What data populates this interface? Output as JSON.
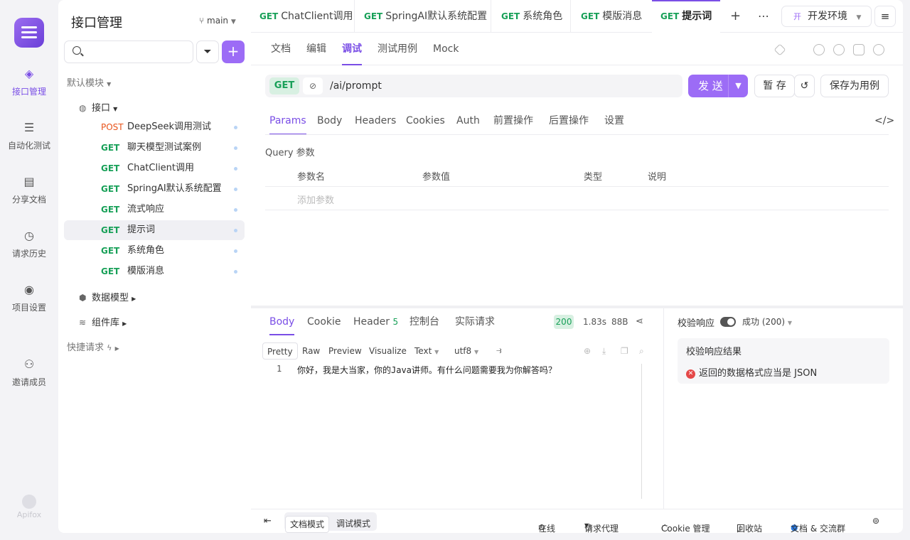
{
  "rail": {
    "items": [
      {
        "label": "接口管理",
        "icon": "api-icon"
      },
      {
        "label": "自动化测试",
        "icon": "automation-icon"
      },
      {
        "label": "分享文档",
        "icon": "book-icon"
      },
      {
        "label": "请求历史",
        "icon": "clock-icon"
      },
      {
        "label": "项目设置",
        "icon": "settings-icon"
      },
      {
        "label": "邀请成员",
        "icon": "add-user-icon"
      }
    ],
    "brand": "Apifox"
  },
  "sidebar": {
    "title": "接口管理",
    "branch": "main",
    "default_module": "默认模块",
    "api_folder": "接口",
    "items": [
      {
        "method": "POST",
        "name": "DeepSeek调用测试"
      },
      {
        "method": "GET",
        "name": "聊天模型测试案例"
      },
      {
        "method": "GET",
        "name": "ChatClient调用"
      },
      {
        "method": "GET",
        "name": "SpringAI默认系统配置"
      },
      {
        "method": "GET",
        "name": "流式响应"
      },
      {
        "method": "GET",
        "name": "提示词"
      },
      {
        "method": "GET",
        "name": "系统角色"
      },
      {
        "method": "GET",
        "name": "模版消息"
      }
    ],
    "data_models": "数据模型",
    "components": "组件库",
    "quick_requests": "快捷请求"
  },
  "tabs": [
    {
      "method": "GET",
      "label": "ChatClient调用"
    },
    {
      "method": "GET",
      "label": "SpringAI默认系统配置"
    },
    {
      "method": "GET",
      "label": "系统角色"
    },
    {
      "method": "GET",
      "label": "模版消息"
    },
    {
      "method": "GET",
      "label": "提示词"
    }
  ],
  "env": {
    "badge": "开",
    "label": "开发环境"
  },
  "subtabs": [
    "文档",
    "编辑",
    "调试",
    "测试用例",
    "Mock"
  ],
  "request": {
    "method": "GET",
    "path": "/ai/prompt",
    "send": "发 送",
    "save_temp": "暂 存",
    "save_case": "保存为用例"
  },
  "param_tabs": [
    "Params",
    "Body",
    "Headers",
    "Cookies",
    "Auth",
    "前置操作",
    "后置操作",
    "设置"
  ],
  "query": {
    "label": "Query 参数",
    "columns": [
      "参数名",
      "参数值",
      "类型",
      "说明"
    ],
    "add_placeholder": "添加参数"
  },
  "response": {
    "tabs": [
      "Body",
      "Cookie",
      "Header",
      "控制台",
      "实际请求"
    ],
    "header_count": "5",
    "status": "200",
    "time": "1.83s",
    "size": "88B",
    "formats": [
      "Pretty",
      "Raw",
      "Preview",
      "Visualize"
    ],
    "type": "Text",
    "encoding": "utf8",
    "line_no": "1",
    "body": "你好，我是大当家，你的Java讲师。有什么问题需要我为你解答吗？"
  },
  "validation": {
    "label": "校验响应",
    "state": "成功 (200)",
    "result_title": "校验响应结果",
    "error": "返回的数据格式应当是 JSON"
  },
  "footer": {
    "doc_mode": "文档模式",
    "debug_mode": "调试模式",
    "online": "在线",
    "proxy": "请求代理",
    "cookie": "Cookie 管理",
    "trash": "回收站",
    "community": "文档 & 交流群"
  }
}
